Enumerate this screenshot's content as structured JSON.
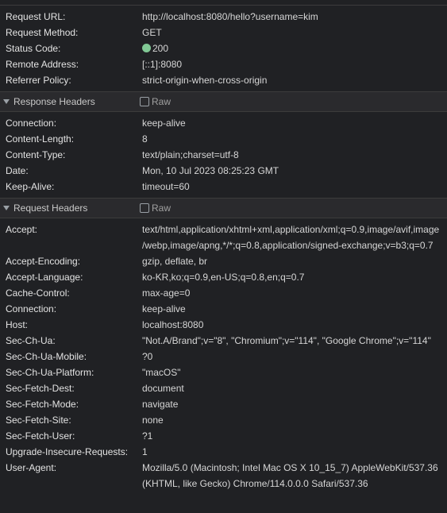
{
  "general": {
    "rows": [
      {
        "key": "Request URL:",
        "value": "http://localhost:8080/hello?username=kim"
      },
      {
        "key": "Request Method:",
        "value": "GET"
      },
      {
        "key": "Status Code:",
        "value": "200"
      },
      {
        "key": "Remote Address:",
        "value": "[::1]:8080"
      },
      {
        "key": "Referrer Policy:",
        "value": "strict-origin-when-cross-origin"
      }
    ]
  },
  "response_headers": {
    "title": "Response Headers",
    "raw_label": "Raw",
    "rows": [
      {
        "key": "Connection:",
        "value": "keep-alive"
      },
      {
        "key": "Content-Length:",
        "value": "8"
      },
      {
        "key": "Content-Type:",
        "value": "text/plain;charset=utf-8"
      },
      {
        "key": "Date:",
        "value": "Mon, 10 Jul 2023 08:25:23 GMT"
      },
      {
        "key": "Keep-Alive:",
        "value": "timeout=60"
      }
    ]
  },
  "request_headers": {
    "title": "Request Headers",
    "raw_label": "Raw",
    "accept": {
      "key": "Accept:",
      "line1": "text/html,application/xhtml+xml,application/xml;q=0.9,image/avif,image",
      "line2": "/webp,image/apng,*/*;q=0.8,application/signed-exchange;v=b3;q=0.7"
    },
    "rows": [
      {
        "key": "Accept-Encoding:",
        "value": "gzip, deflate, br"
      },
      {
        "key": "Accept-Language:",
        "value": "ko-KR,ko;q=0.9,en-US;q=0.8,en;q=0.7"
      },
      {
        "key": "Cache-Control:",
        "value": "max-age=0"
      },
      {
        "key": "Connection:",
        "value": "keep-alive"
      },
      {
        "key": "Host:",
        "value": "localhost:8080"
      },
      {
        "key": "Sec-Ch-Ua:",
        "value": "\"Not.A/Brand\";v=\"8\", \"Chromium\";v=\"114\", \"Google Chrome\";v=\"114\""
      },
      {
        "key": "Sec-Ch-Ua-Mobile:",
        "value": "?0"
      },
      {
        "key": "Sec-Ch-Ua-Platform:",
        "value": "\"macOS\""
      },
      {
        "key": "Sec-Fetch-Dest:",
        "value": "document"
      },
      {
        "key": "Sec-Fetch-Mode:",
        "value": "navigate"
      },
      {
        "key": "Sec-Fetch-Site:",
        "value": "none"
      },
      {
        "key": "Sec-Fetch-User:",
        "value": "?1"
      },
      {
        "key": "Upgrade-Insecure-Requests:",
        "value": "1"
      }
    ],
    "user_agent": {
      "key": "User-Agent:",
      "line1": "Mozilla/5.0 (Macintosh; Intel Mac OS X 10_15_7) AppleWebKit/537.36",
      "line2": "(KHTML, like Gecko) Chrome/114.0.0.0 Safari/537.36"
    }
  },
  "colors": {
    "background": "#202124",
    "status_ok": "#81c995"
  },
  "icons": {
    "status": "status-dot-icon",
    "collapse": "triangle-down-icon",
    "checkbox": "checkbox-icon"
  }
}
